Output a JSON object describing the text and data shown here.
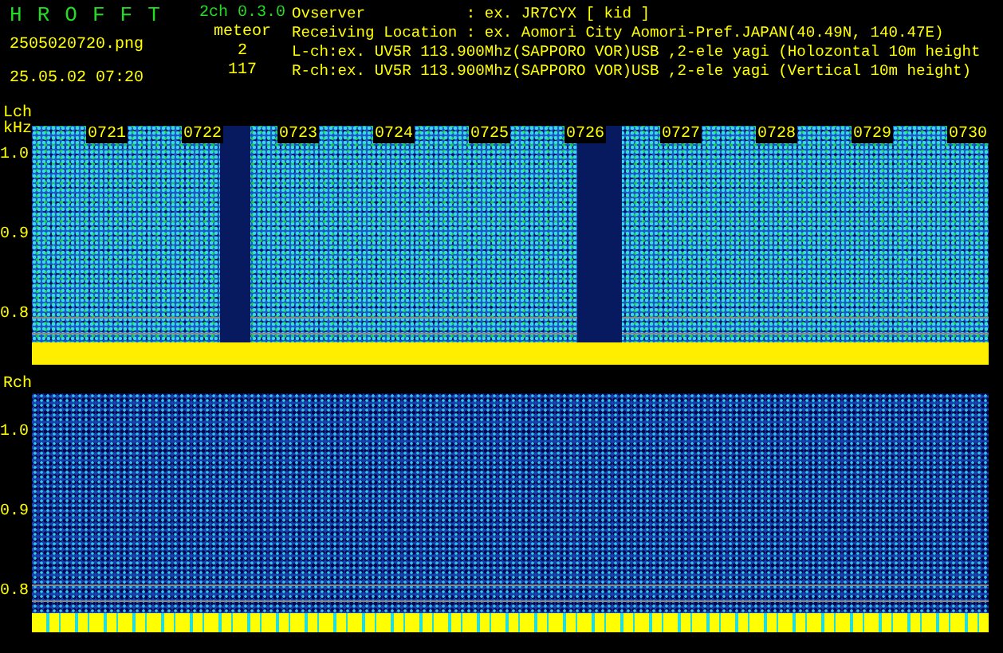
{
  "header": {
    "title_letters": [
      "H",
      "R",
      "O",
      "F",
      "F",
      "T"
    ],
    "version": "2ch 0.3.0",
    "filename": "2505020720.png",
    "timestamp": "25.05.02 07:20",
    "mode": "meteor",
    "counts": [
      "2",
      "117"
    ],
    "info": [
      "Ovserver           : ex. JR7CYX [ kid ]",
      "Receiving Location : ex. Aomori City Aomori-Pref.JAPAN(40.49N, 140.47E)",
      "L-ch:ex. UV5R 113.900Mhz(SAPPORO VOR)USB ,2-ele yagi (Holozontal 10m height",
      "R-ch:ex. UV5R 113.900Mhz(SAPPORO VOR)USB ,2-ele yagi (Vertical 10m height)"
    ]
  },
  "channels": [
    {
      "kind": "left",
      "label": "Lch",
      "unit": "kHz",
      "time_labels": [
        "0721",
        "0722",
        "0723",
        "0724",
        "0725",
        "0726",
        "0727",
        "0728",
        "0729",
        "0730"
      ],
      "y_labels": [
        "1.0",
        "0.9",
        "0.8"
      ]
    },
    {
      "kind": "right",
      "label": "Rch",
      "y_labels": [
        "1.0",
        "0.9",
        "0.8"
      ]
    }
  ]
}
